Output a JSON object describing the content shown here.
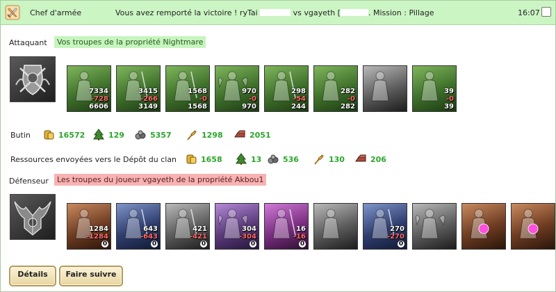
{
  "header": {
    "category": "Chef d'armée",
    "msg_prefix": "Vous avez remporté la victoire ! ryTai",
    "msg_vs": "vs vgayeth [",
    "msg_suffix": ". Mission : Pillage",
    "time": "16:07"
  },
  "attacker": {
    "label": "Attaquant",
    "tag": "Vos troupes de la propriété Nightmare",
    "units": [
      {
        "art": "dwarf",
        "color": "green",
        "n1": "7334",
        "n2": "-728",
        "n3": "6606"
      },
      {
        "art": "elf-sword",
        "color": "green",
        "n1": "3415",
        "n2": "-266",
        "n3": "3149"
      },
      {
        "art": "knight",
        "color": "green",
        "n1": "1568",
        "n2": "-0",
        "n3": "1568"
      },
      {
        "art": "griffin",
        "color": "green",
        "n1": "970",
        "n2": "-0",
        "n3": "970"
      },
      {
        "art": "archer",
        "color": "green",
        "n1": "298",
        "n2": "-54",
        "n3": "244"
      },
      {
        "art": "druid",
        "color": "green",
        "n1": "282",
        "n2": "-0",
        "n3": "282"
      },
      {
        "art": "monk",
        "color": "grey",
        "n1": "",
        "n2": "",
        "n3": ""
      },
      {
        "art": "mage",
        "color": "green",
        "n1": "39",
        "n2": "-0",
        "n3": "39"
      }
    ]
  },
  "loot": {
    "label": "Butin",
    "items": [
      {
        "icon": "gold-icon",
        "value": "16572"
      },
      {
        "icon": "wood-icon",
        "value": "129"
      },
      {
        "icon": "stone-icon",
        "value": "5357"
      },
      {
        "icon": "wheat-icon",
        "value": "1298"
      },
      {
        "icon": "iron-icon",
        "value": "2051"
      }
    ]
  },
  "clan": {
    "label": "Ressources envoyées vers le Dépôt du clan",
    "items": [
      {
        "icon": "gold-icon",
        "value": "1658"
      },
      {
        "icon": "wood-icon",
        "value": "13"
      },
      {
        "icon": "stone-icon",
        "value": "536"
      },
      {
        "icon": "wheat-icon",
        "value": "130"
      },
      {
        "icon": "iron-icon",
        "value": "206"
      }
    ]
  },
  "defender": {
    "label": "Défenseur",
    "tag": "Les troupes du joueur vgayeth de la propriété Akbou1",
    "units": [
      {
        "art": "gargoyle",
        "color": "rust",
        "n1": "1284",
        "n2": "-1284",
        "n3": "0"
      },
      {
        "art": "assassin",
        "color": "navy",
        "n1": "643",
        "n2": "-643",
        "n3": "0"
      },
      {
        "art": "lizard",
        "color": "grey",
        "n1": "421",
        "n2": "-421",
        "n3": "0"
      },
      {
        "art": "harpy",
        "color": "purple",
        "n1": "304",
        "n2": "-304",
        "n3": "0"
      },
      {
        "art": "crossbow",
        "color": "magenta",
        "n1": "16",
        "n2": "-16",
        "n3": "0"
      },
      {
        "art": "shade",
        "color": "grey",
        "n1": "",
        "n2": "",
        "n3": ""
      },
      {
        "art": "dark-knight",
        "color": "navy",
        "n1": "270",
        "n2": "-270",
        "n3": "0"
      },
      {
        "art": "demon",
        "color": "grey",
        "n1": "",
        "n2": "",
        "n3": ""
      },
      {
        "art": "orb-beast",
        "color": "rust",
        "n1": "",
        "n2": "",
        "n3": ""
      },
      {
        "art": "orb-beast-2",
        "color": "rust",
        "n1": "",
        "n2": "",
        "n3": ""
      }
    ]
  },
  "buttons": {
    "details": "Détails",
    "follow": "Faire suivre"
  },
  "colors": {
    "header_bg": "#ccf5c4",
    "attacker_tag_bg": "#c6f5bd",
    "defender_tag_bg": "#f7b2b2",
    "loot_value": "#2aa62a",
    "loss_value": "#ff6a6a"
  }
}
